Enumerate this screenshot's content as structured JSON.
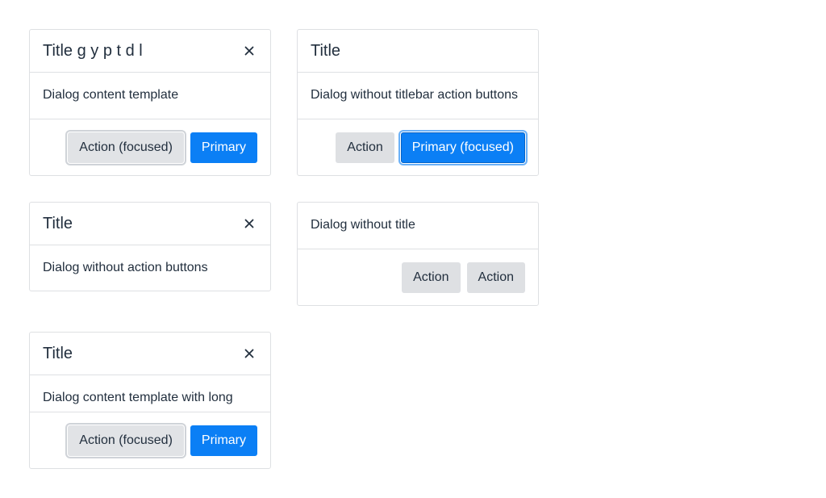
{
  "dialogs": [
    {
      "title": "Title g y p t d l",
      "content": "Dialog content template",
      "buttons": [
        {
          "label": "Action (focused)"
        },
        {
          "label": "Primary"
        }
      ]
    },
    {
      "title": "Title",
      "content": "Dialog without titlebar action buttons",
      "buttons": [
        {
          "label": "Action"
        },
        {
          "label": "Primary (focused)"
        }
      ]
    },
    {
      "title": "Title",
      "content": "Dialog without action buttons"
    },
    {
      "content": "Dialog without title",
      "buttons": [
        {
          "label": "Action"
        },
        {
          "label": "Action"
        }
      ]
    },
    {
      "title": "Title",
      "content": "Dialog content template with long",
      "buttons": [
        {
          "label": "Action (focused)"
        },
        {
          "label": "Primary"
        }
      ]
    }
  ],
  "icons": {
    "close": "close-icon"
  },
  "colors": {
    "primary": "#0b7ff5",
    "secondary": "#dee0e3",
    "text": "#222f3e",
    "border": "#dee0e3"
  }
}
